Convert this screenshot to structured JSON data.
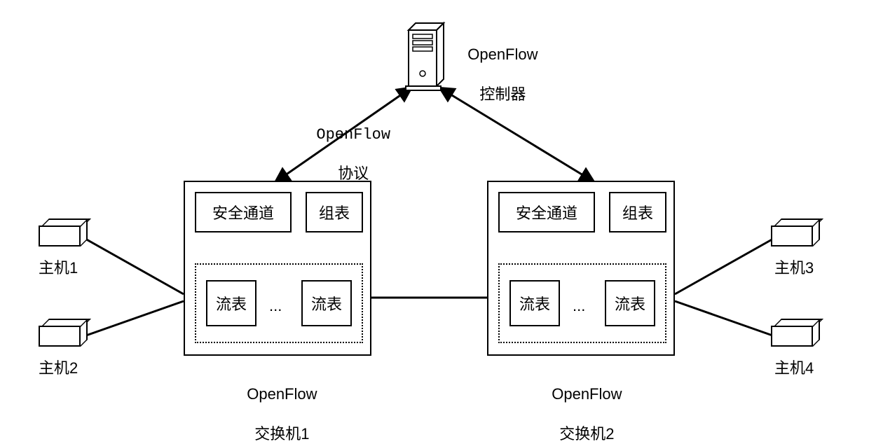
{
  "controller": {
    "title_line1": "OpenFlow",
    "title_line2": "控制器"
  },
  "protocol": {
    "line1": "OpenFlow",
    "line2": "协议"
  },
  "switch1": {
    "secure_channel": "安全通道",
    "group_table": "组表",
    "flow_table": "流表",
    "ellipsis": "...",
    "caption_line1": "OpenFlow",
    "caption_line2": "交换机1"
  },
  "switch2": {
    "secure_channel": "安全通道",
    "group_table": "组表",
    "flow_table": "流表",
    "ellipsis": "...",
    "caption_line1": "OpenFlow",
    "caption_line2": "交换机2"
  },
  "hosts": {
    "h1": "主机1",
    "h2": "主机2",
    "h3": "主机3",
    "h4": "主机4"
  }
}
